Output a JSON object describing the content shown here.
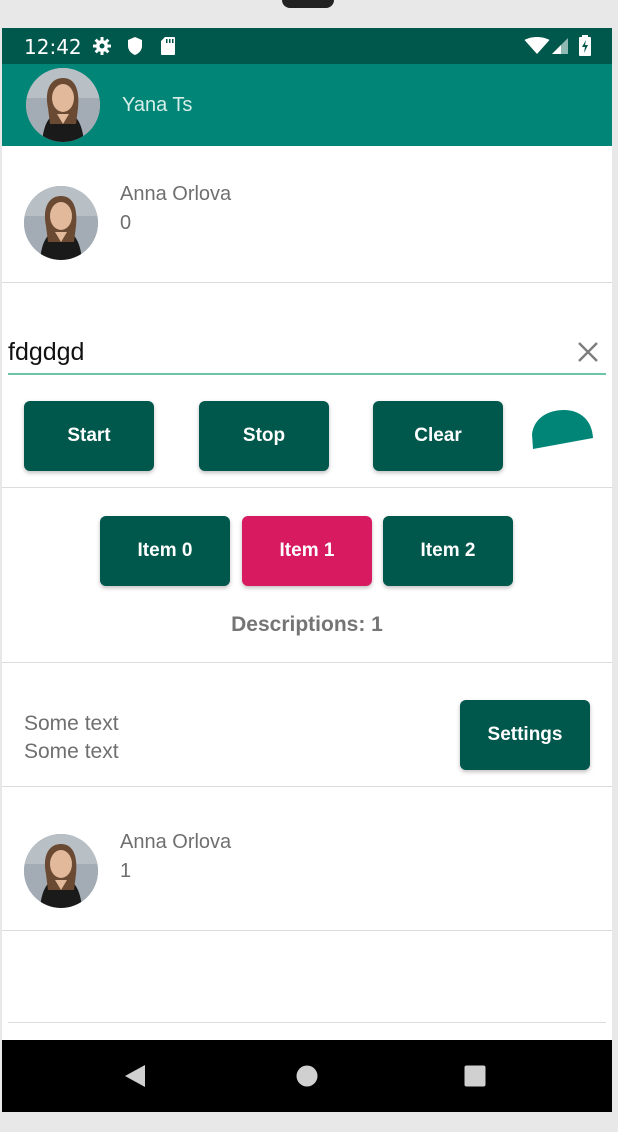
{
  "status_bar": {
    "time": "12:42",
    "icons": [
      "gear-icon",
      "shield-icon",
      "sd-card-icon",
      "wifi-icon",
      "signal-icon",
      "battery-icon"
    ]
  },
  "app_bar": {
    "title": "Yana Ts",
    "color": "#008577"
  },
  "list_items": [
    {
      "name": "Anna Orlova",
      "count": "0"
    },
    {
      "name": "Anna Orlova",
      "count": "1"
    }
  ],
  "input": {
    "value": "fdgdgd"
  },
  "controls": {
    "start_label": "Start",
    "stop_label": "Stop",
    "clear_label": "Clear"
  },
  "segmented": {
    "items": [
      "Item 0",
      "Item 1",
      "Item 2"
    ],
    "selected_index": 1,
    "description": "Descriptions: 1"
  },
  "settings_row": {
    "text_line1": "Some text",
    "text_line2": "Some text",
    "button_label": "Settings"
  },
  "colors": {
    "primary_dark": "#00574b",
    "primary": "#008577",
    "accent": "#d81b60"
  }
}
